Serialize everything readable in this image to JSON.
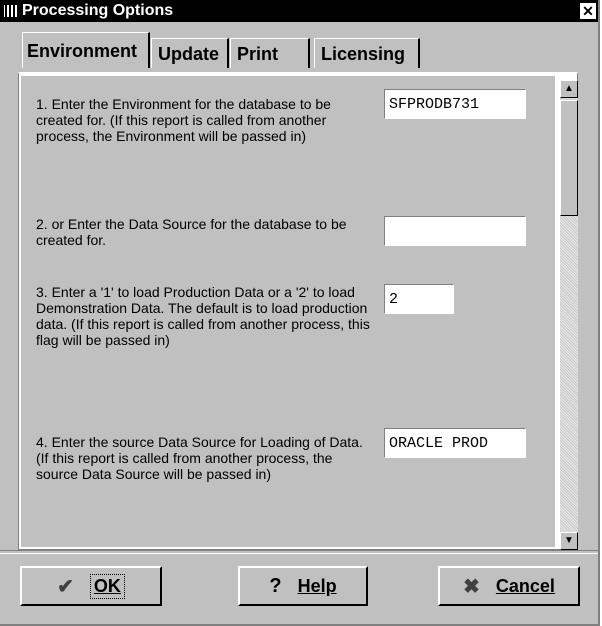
{
  "window": {
    "title": "Processing Options"
  },
  "tabs": [
    {
      "label": "Environment",
      "active": true
    },
    {
      "label": "Update",
      "active": false
    },
    {
      "label": "Print",
      "active": false
    },
    {
      "label": "Licensing",
      "active": false
    }
  ],
  "options": [
    {
      "prompt": "1. Enter the Environment for the database to be created for.  (If this report is called from another process, the Environment will be passed in)",
      "value": "SFPRODB731"
    },
    {
      "prompt": "2. or Enter the Data Source for the database to be created for.",
      "value": ""
    },
    {
      "prompt": "3. Enter a '1' to load Production Data or a '2' to load Demonstration Data.  The default is to load production data.  (If this report is called from another process, this flag will be passed in)",
      "value": "2"
    },
    {
      "prompt": "4. Enter the source Data Source for Loading of Data.  (If this report is called from another process, the source Data Source will be passed in)",
      "value": "ORACLE PROD"
    }
  ],
  "buttons": {
    "ok": {
      "label": "OK",
      "icon": "checkmark-icon"
    },
    "help": {
      "label": "Help",
      "icon": "question-icon"
    },
    "cancel": {
      "label": "Cancel",
      "icon": "x-icon"
    }
  },
  "icons": {
    "title": "app-icon",
    "close": "close-icon",
    "scroll_up": "scroll-up-arrow-icon",
    "scroll_down": "scroll-down-arrow-icon"
  }
}
